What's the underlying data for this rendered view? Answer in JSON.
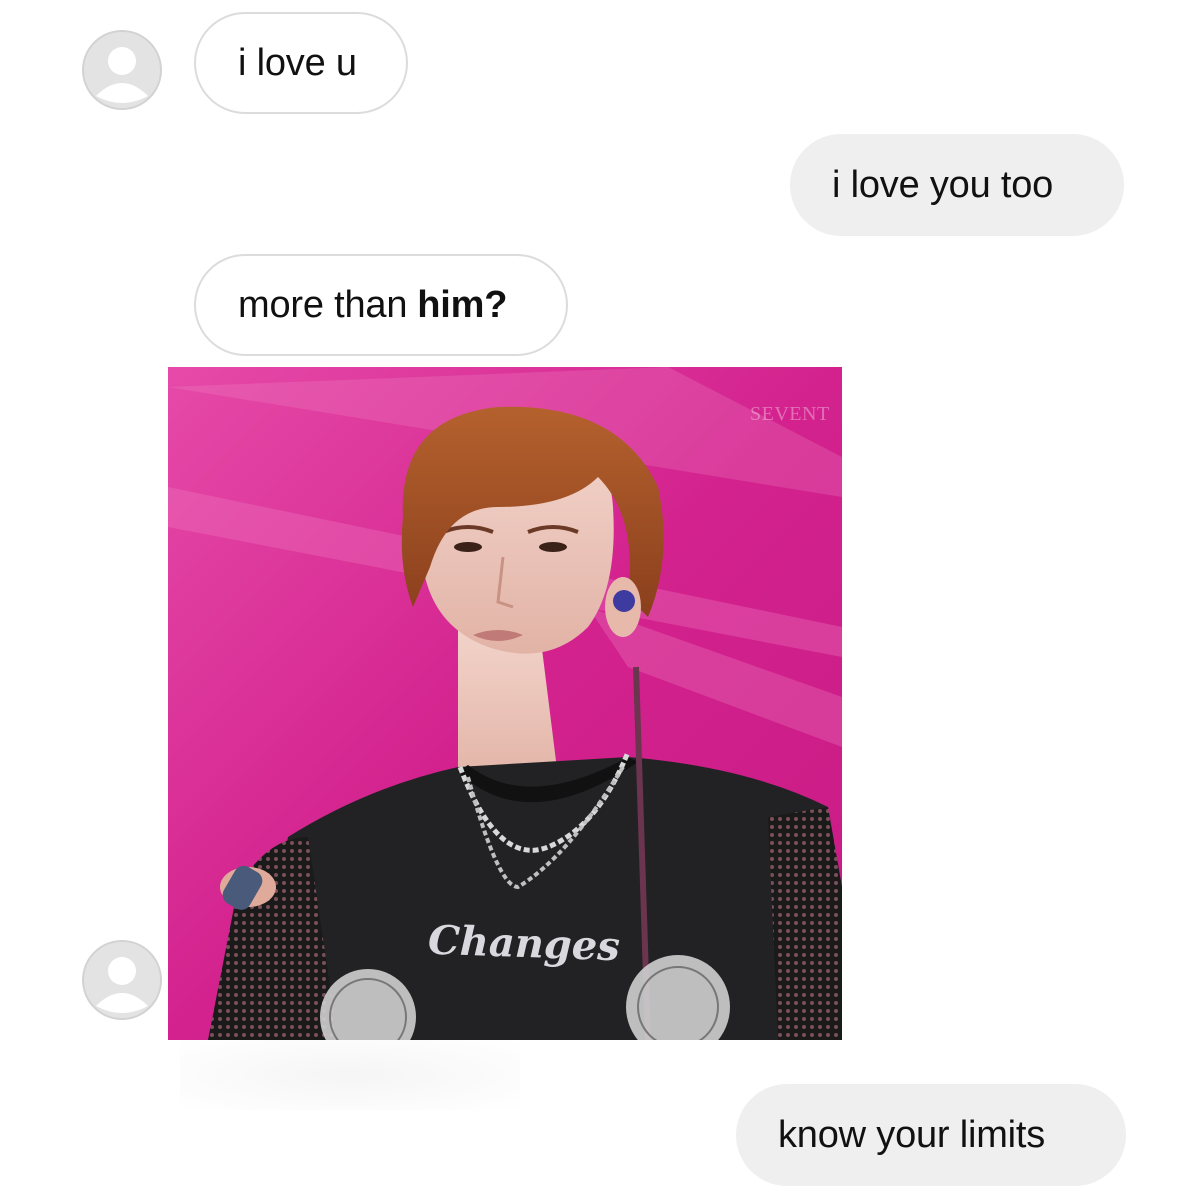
{
  "conversation": {
    "messages": [
      {
        "direction": "incoming",
        "text": "i love u"
      },
      {
        "direction": "outgoing",
        "text": "i love you too"
      },
      {
        "direction": "incoming",
        "text": "more than",
        "emphasis": "him?"
      },
      {
        "direction": "incoming",
        "type": "photo",
        "watermark": "SEVENT",
        "shirt_text": "Changes"
      },
      {
        "direction": "outgoing",
        "text": "know your limits"
      }
    ]
  },
  "colors": {
    "incoming_bubble_border": "#dcdcdc",
    "outgoing_bubble_bg": "#efefef",
    "avatar_bg": "#e3e3e3",
    "photo_background": "#d0258f"
  },
  "icons": {
    "avatar": "default-user-avatar-icon"
  }
}
